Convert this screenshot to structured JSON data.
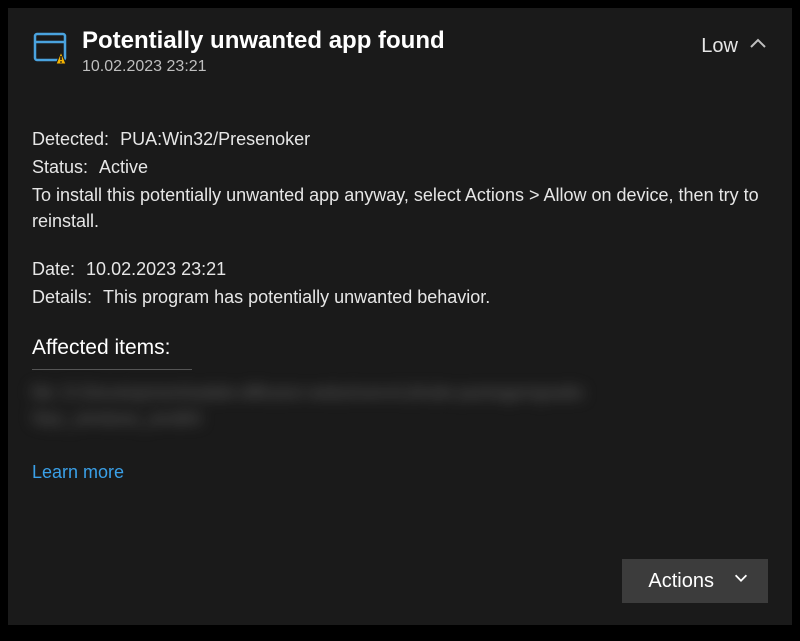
{
  "header": {
    "title": "Potentially unwanted app found",
    "timestamp": "10.02.2023 23:21",
    "severity": "Low"
  },
  "detail": {
    "detectedLabel": "Detected:",
    "detectedValue": "PUA:Win32/Presenoker",
    "statusLabel": "Status:",
    "statusValue": "Active",
    "instructions": "To install this potentially unwanted app anyway, select Actions > Allow on device, then try to reinstall.",
    "dateLabel": "Date:",
    "dateValue": "10.02.2023 23:21",
    "detailsLabel": "Details:",
    "detailsValue": "This program has potentially unwanted behavior."
  },
  "affected": {
    "heading": "Affected items:",
    "items": [
      "file: D:\\Development\\stable-diffusion-webui\\venv\\Lib\\site-packages\\gradio",
      "\\frpc_windows_amd64"
    ]
  },
  "links": {
    "learnMore": "Learn more"
  },
  "footer": {
    "actionsLabel": "Actions"
  }
}
